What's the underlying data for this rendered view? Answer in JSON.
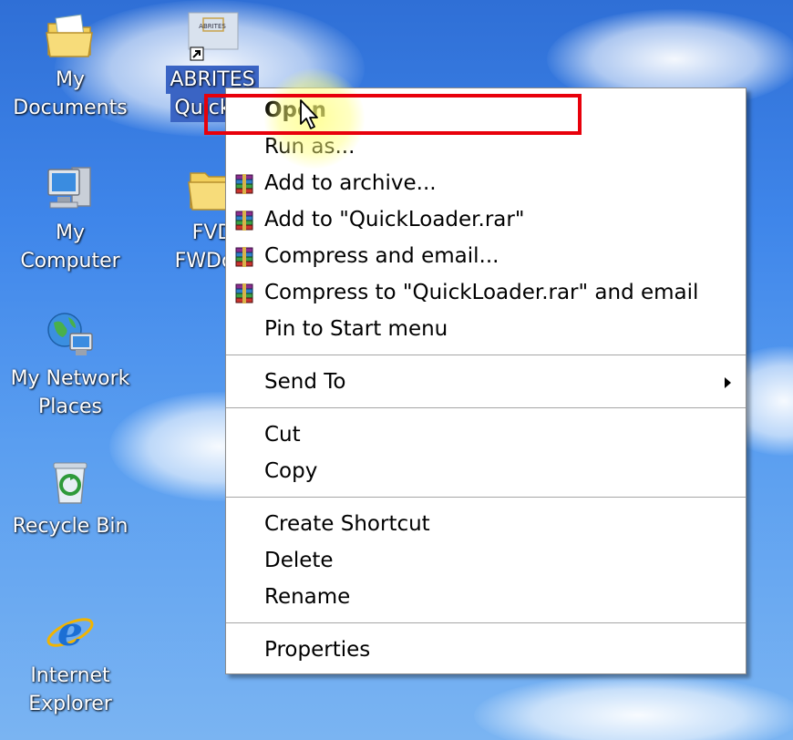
{
  "desktop": {
    "icons": [
      {
        "label_line1": "My",
        "label_line2": "Documents"
      },
      {
        "label_line1": "ABRITES",
        "label_line2": "Quick S"
      },
      {
        "label_line1": "My",
        "label_line2": "Computer"
      },
      {
        "label_line1": "FVD",
        "label_line2": "FWDow"
      },
      {
        "label_line1": "My Network",
        "label_line2": "Places"
      },
      {
        "label_line1": "Recycle Bin",
        "label_line2": ""
      },
      {
        "label_line1": "Internet",
        "label_line2": "Explorer"
      }
    ],
    "shortcut_logo_text": "ABRITES"
  },
  "context_menu": {
    "items": [
      {
        "label": "Open",
        "bold": true,
        "icon": ""
      },
      {
        "label": "Run as...",
        "icon": ""
      },
      {
        "label": "Add to archive...",
        "icon": "winrar-icon"
      },
      {
        "label": "Add to \"QuickLoader.rar\"",
        "icon": "winrar-icon"
      },
      {
        "label": "Compress and email...",
        "icon": "winrar-icon"
      },
      {
        "label": "Compress to \"QuickLoader.rar\" and email",
        "icon": "winrar-icon"
      },
      {
        "label": "Pin to Start menu",
        "icon": ""
      },
      {
        "label": "Send To",
        "icon": "",
        "submenu": true
      },
      {
        "label": "Cut",
        "icon": ""
      },
      {
        "label": "Copy",
        "icon": ""
      },
      {
        "label": "Create Shortcut",
        "icon": ""
      },
      {
        "label": "Delete",
        "icon": ""
      },
      {
        "label": "Rename",
        "icon": ""
      },
      {
        "label": "Properties",
        "icon": ""
      }
    ]
  },
  "colors": {
    "highlight_box": "#e8000b",
    "selection": "#3a64c4",
    "desktop_sky": "#3f86ea"
  }
}
